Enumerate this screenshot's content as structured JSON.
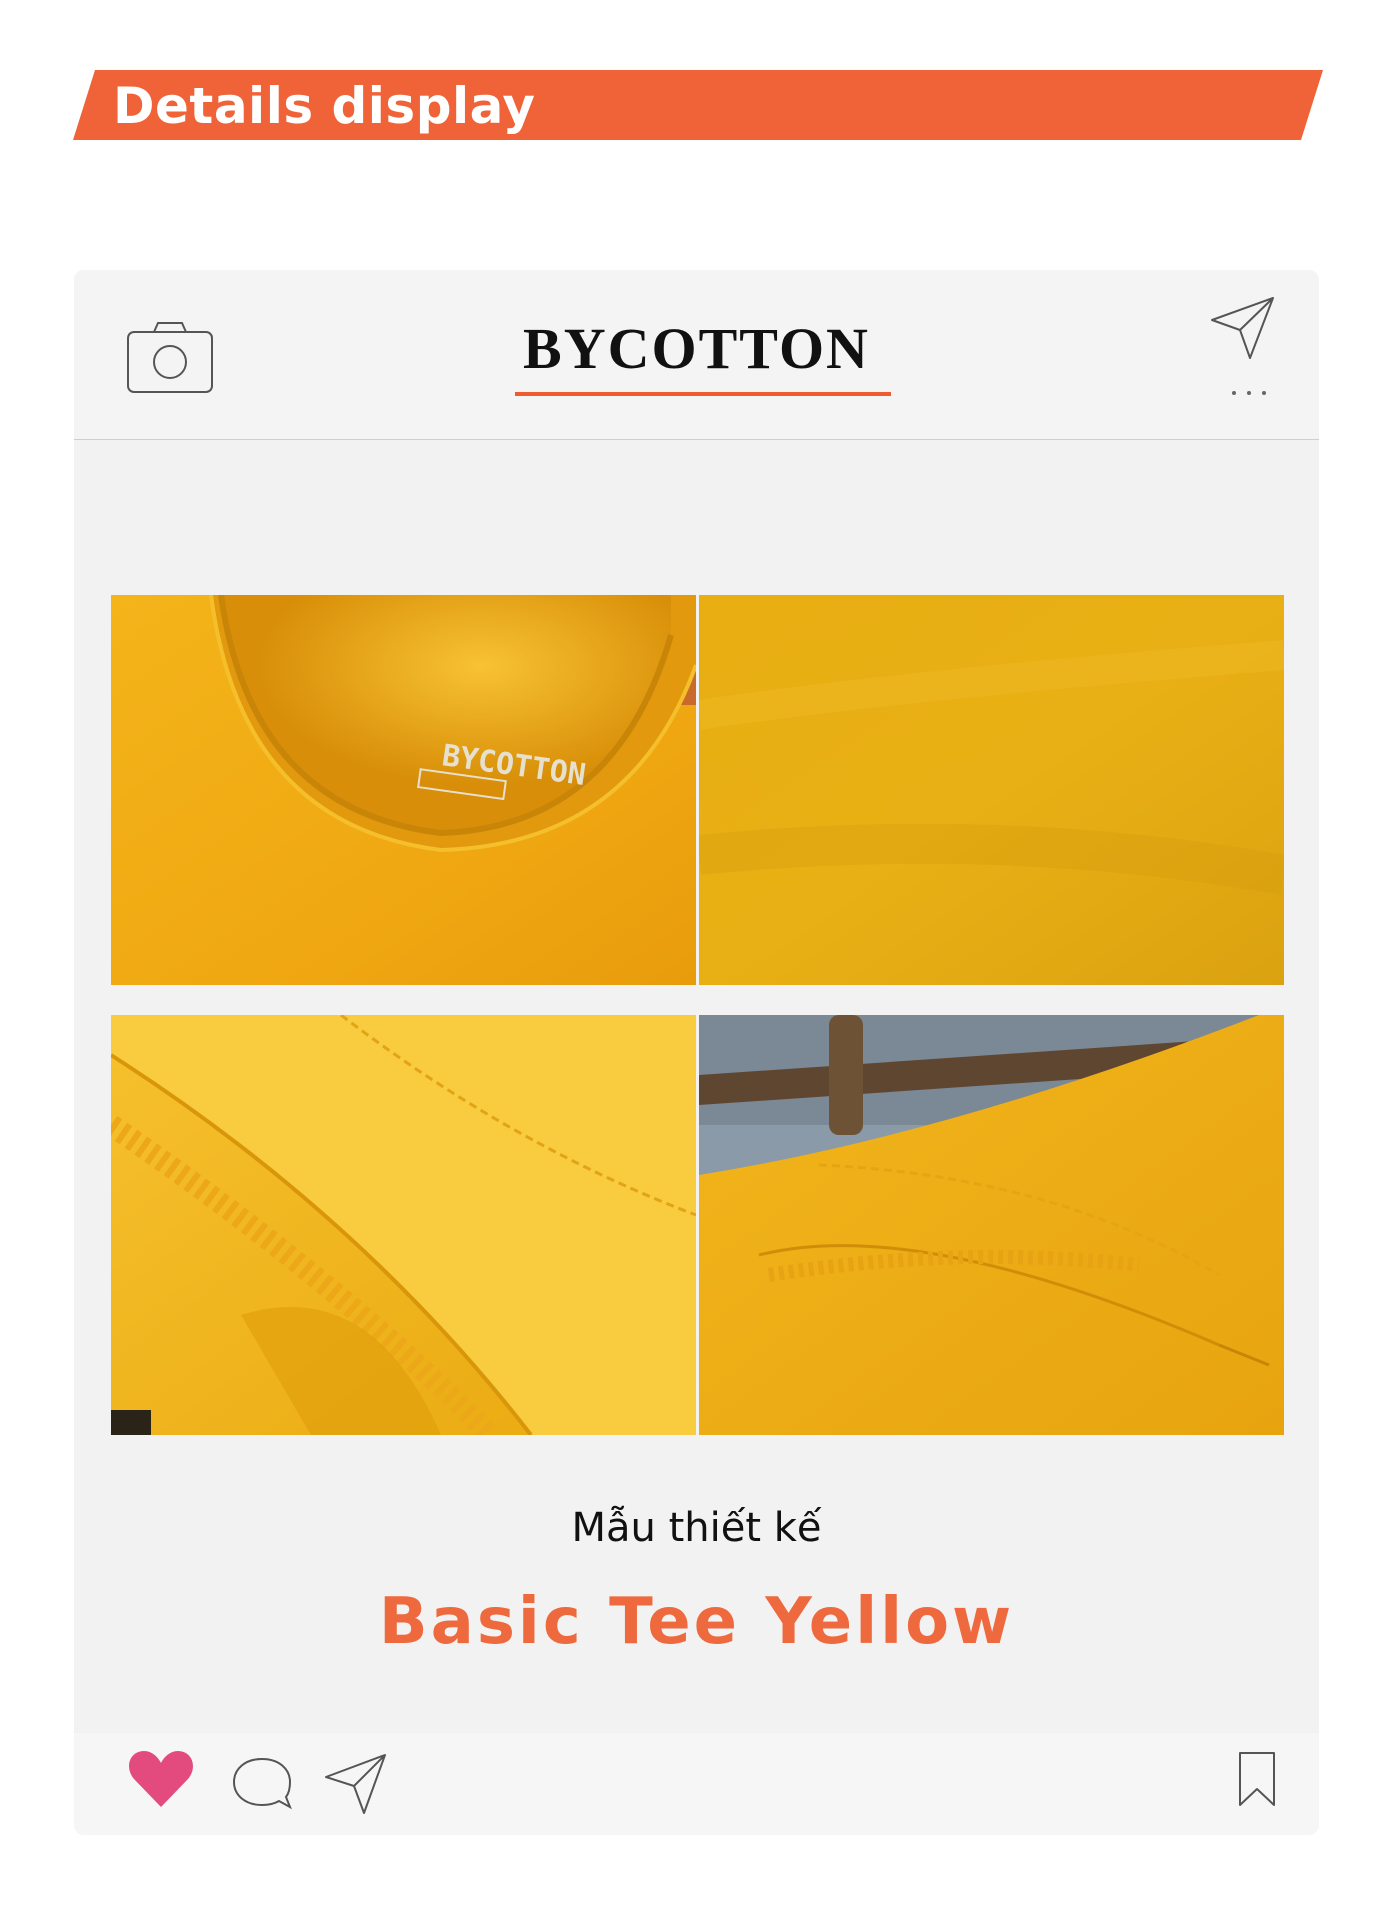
{
  "banner": {
    "title": "Details display",
    "color": "#f06237"
  },
  "card": {
    "brand": "BYCOTTON",
    "accent_color": "#ef5a2f",
    "header_icons": [
      "camera-icon",
      "send-icon",
      "more-icon"
    ],
    "photos": [
      {
        "label": "BYCOTTON",
        "description_icon": "collar-tag-photo"
      },
      {
        "description_icon": "fabric-photo"
      },
      {
        "description_icon": "seam-photo"
      },
      {
        "description_icon": "sleeve-hem-photo"
      }
    ],
    "subtitle": "Mẫu thiết kế",
    "product_name": "Basic Tee Yellow",
    "product_color": "#ee6a3e",
    "footer_icons": [
      "heart-icon",
      "comment-icon",
      "send-icon",
      "bookmark-icon"
    ]
  }
}
